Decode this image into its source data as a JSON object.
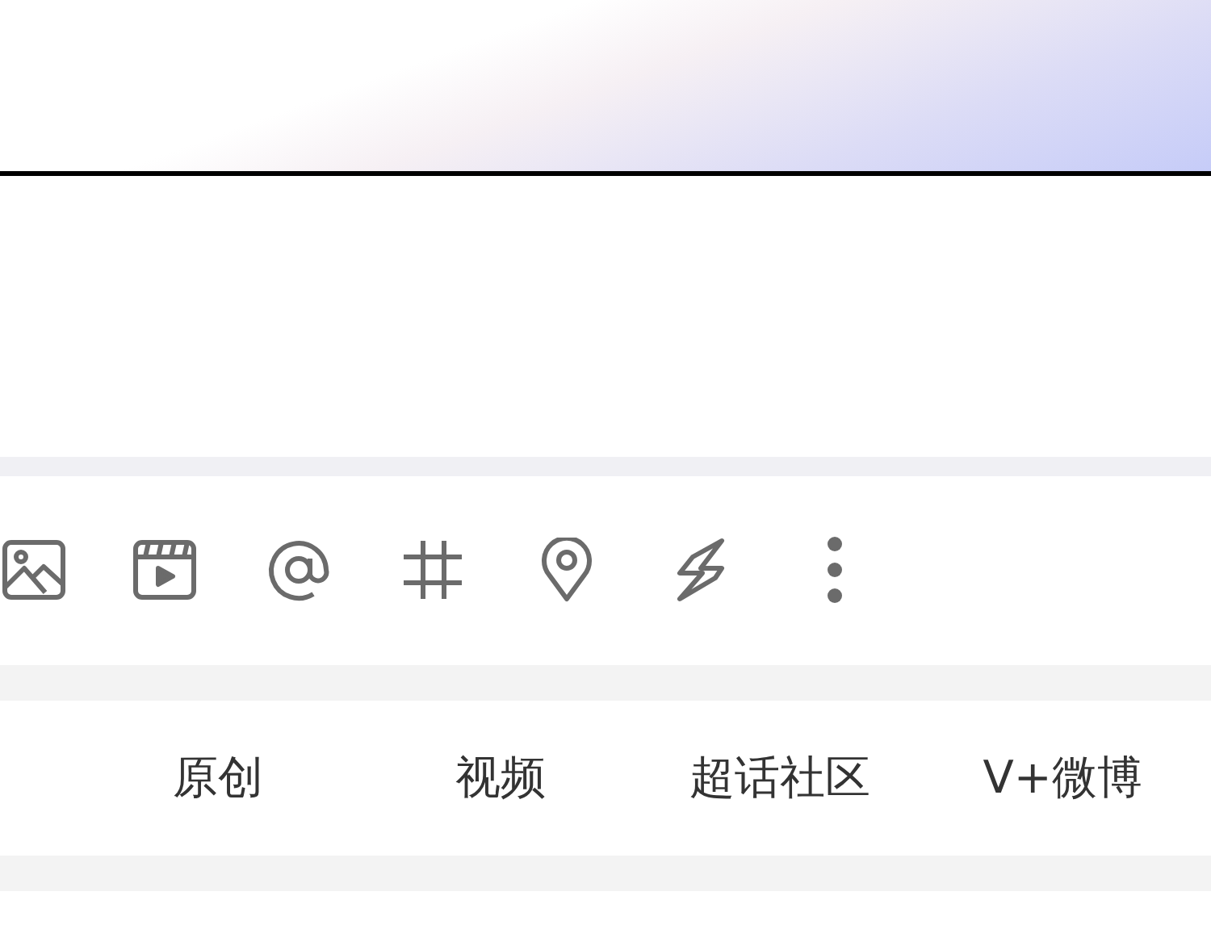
{
  "filter_tabs": [
    {
      "label": "原创"
    },
    {
      "label": "视频"
    },
    {
      "label": "超话社区"
    },
    {
      "label": "V+微博"
    }
  ]
}
